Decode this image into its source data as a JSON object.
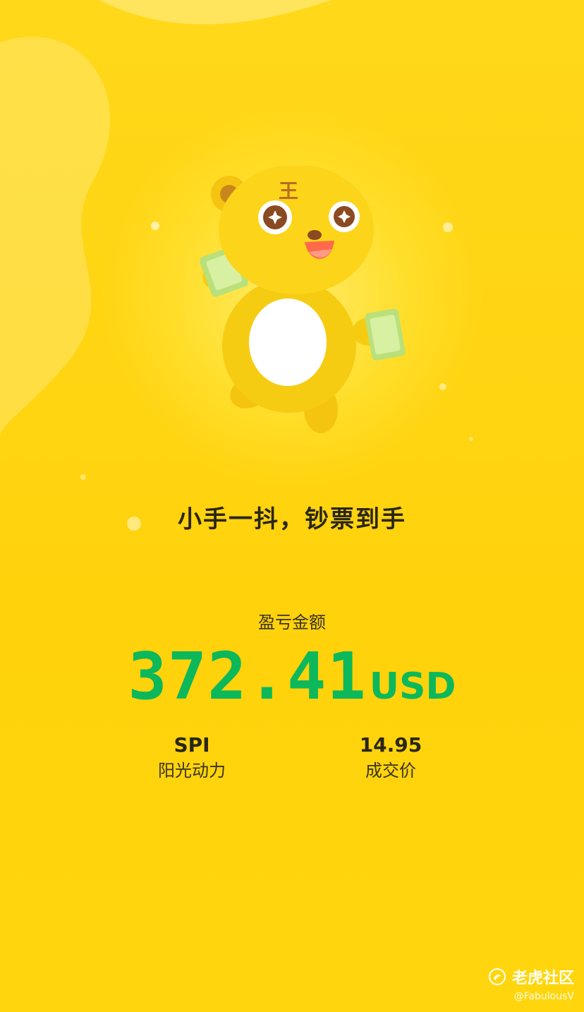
{
  "slogan": "小手一抖，钞票到手",
  "pl": {
    "label": "盈亏金额",
    "amount": "372.41",
    "currency": "USD",
    "color": "#0cb85a"
  },
  "stock": {
    "symbol": "SPI",
    "name": "阳光动力"
  },
  "trade": {
    "price": "14.95",
    "price_label": "成交价"
  },
  "watermark": {
    "brand": "老虎社区",
    "handle": "@FabulousV",
    "logo_icon": "tiger-community-logo-icon"
  },
  "mascot": {
    "icon": "tiger-mascot-holding-cash-icon"
  },
  "colors": {
    "background": "#ffd60e",
    "glow": "#ffec6a",
    "text_dark": "#2a2615",
    "profit_green": "#0cb85a"
  }
}
